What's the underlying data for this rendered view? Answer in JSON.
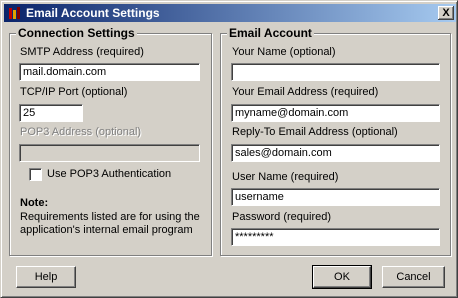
{
  "window": {
    "title": "Email Account Settings",
    "close_label": "X"
  },
  "connection": {
    "legend": "Connection Settings",
    "smtp_label": "SMTP Address (required)",
    "smtp_value": "mail.domain.com",
    "port_label": "TCP/IP Port (optional)",
    "port_value": "25",
    "pop3_label": "POP3 Address (optional)",
    "pop3_value": "",
    "pop3_auth_label": "Use POP3 Authentication",
    "note_title": "Note:",
    "note_text": "Requirements listed are for using the application's internal email program"
  },
  "account": {
    "legend": "Email Account",
    "name_label": "Your Name (optional)",
    "name_value": "",
    "email_label": "Your Email Address (required)",
    "email_value": "myname@domain.com",
    "reply_label": "Reply-To Email Address (optional)",
    "reply_value": "sales@domain.com",
    "user_label": "User Name (required)",
    "user_value": "username",
    "pass_label": "Password (required)",
    "pass_value": "*********"
  },
  "buttons": {
    "help": "Help",
    "ok": "OK",
    "cancel": "Cancel"
  }
}
